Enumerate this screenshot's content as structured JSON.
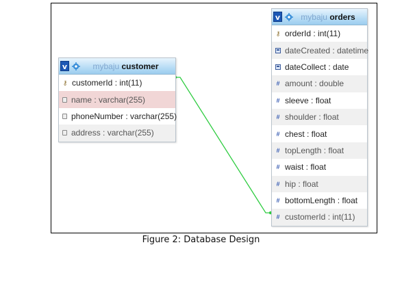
{
  "customer": {
    "database": "mybaju",
    "table": "customer",
    "toggle_label": "v",
    "columns": [
      {
        "text": "customerId : int(11)",
        "icon": "key-icon"
      },
      {
        "text": "name : varchar(255)",
        "icon": "string-icon"
      },
      {
        "text": "phoneNumber : varchar(255)",
        "icon": "string-icon"
      },
      {
        "text": "address : varchar(255)",
        "icon": "string-icon"
      }
    ]
  },
  "orders": {
    "database": "mybaju",
    "table": "orders",
    "toggle_label": "v",
    "columns": [
      {
        "text": "orderId : int(11)",
        "icon": "key-icon"
      },
      {
        "text": "dateCreated : datetime",
        "icon": "calendar-icon"
      },
      {
        "text": "dateCollect : date",
        "icon": "calendar-icon"
      },
      {
        "text": "amount : double",
        "icon": "number-icon"
      },
      {
        "text": "sleeve : float",
        "icon": "number-icon"
      },
      {
        "text": "shoulder : float",
        "icon": "number-icon"
      },
      {
        "text": "chest : float",
        "icon": "number-icon"
      },
      {
        "text": "topLength : float",
        "icon": "number-icon"
      },
      {
        "text": "waist : float",
        "icon": "number-icon"
      },
      {
        "text": "hip : float",
        "icon": "number-icon"
      },
      {
        "text": "bottomLength : float",
        "icon": "number-icon"
      },
      {
        "text": "customerId : int(11)",
        "icon": "number-icon"
      }
    ]
  },
  "caption": "Figure 2: Database Design",
  "relation_color": "#2ecc40"
}
